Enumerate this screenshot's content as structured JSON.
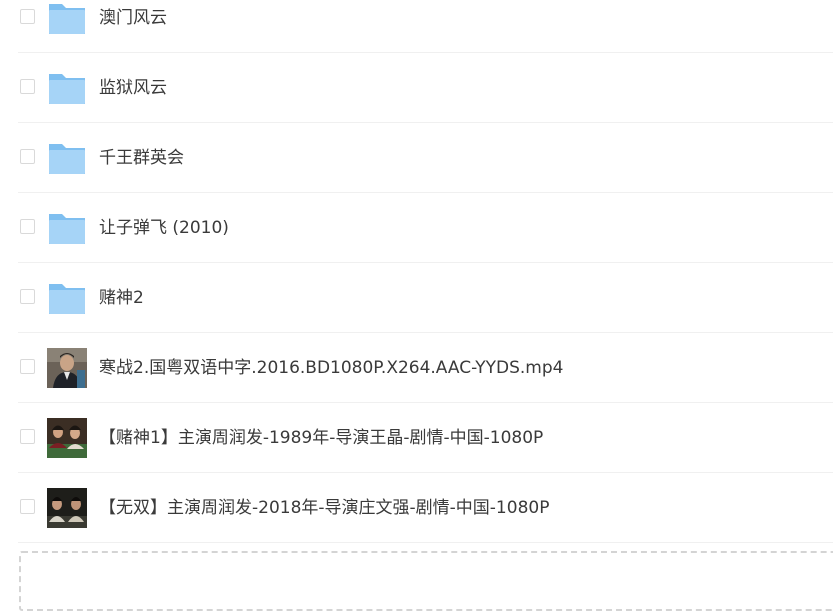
{
  "files": [
    {
      "name": "澳门风云",
      "type": "folder"
    },
    {
      "name": "监狱风云",
      "type": "folder"
    },
    {
      "name": "千王群英会",
      "type": "folder"
    },
    {
      "name": "让子弹飞 (2010)",
      "type": "folder"
    },
    {
      "name": "赌神2",
      "type": "folder"
    },
    {
      "name": "寒战2.国粤双语中字.2016.BD1080P.X264.AAC-YYDS.mp4",
      "type": "video"
    },
    {
      "name": "【赌神1】主演周润发-1989年-导演王晶-剧情-中国-1080P",
      "type": "video"
    },
    {
      "name": "【无双】主演周润发-2018年-导演庄文强-剧情-中国-1080P",
      "type": "video"
    }
  ],
  "icons": {
    "folder": "folder-icon",
    "video": "video-thumbnail"
  },
  "colors": {
    "folder_back": "#7fbff0",
    "folder_front": "#a6d4f7",
    "text": "#3a3a3a",
    "divider": "#f0f0f0"
  }
}
